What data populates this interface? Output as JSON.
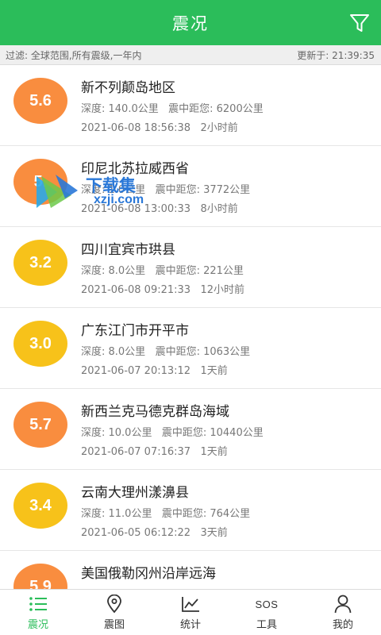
{
  "header": {
    "title": "震况",
    "filter_icon": "filter-icon"
  },
  "filter": {
    "text": "过滤: 全球范围,所有震级,一年内",
    "updated": "更新于: 21:39:35"
  },
  "colors": {
    "green": "#2bbd5a",
    "orange": "#f98d3f",
    "yellow": "#f7c21a"
  },
  "quakes": [
    {
      "mag": "5.6",
      "place": "新不列颠岛地区",
      "info": "深度: 140.0公里   震中距您: 6200公里",
      "time": "2021-06-08 18:56:38   2小时前",
      "color": "#f98d3f"
    },
    {
      "mag": "5.",
      "place": "印尼北苏拉威西省",
      "info": "深度: 1.0公里   震中距您: 3772公里",
      "time": "2021-06-08 13:00:33   8小时前",
      "color": "#f98d3f"
    },
    {
      "mag": "3.2",
      "place": "四川宜宾市珙县",
      "info": "深度: 8.0公里   震中距您: 221公里",
      "time": "2021-06-08 09:21:33   12小时前",
      "color": "#f7c21a"
    },
    {
      "mag": "3.0",
      "place": "广东江门市开平市",
      "info": "深度: 8.0公里   震中距您: 1063公里",
      "time": "2021-06-07 20:13:12   1天前",
      "color": "#f7c21a"
    },
    {
      "mag": "5.7",
      "place": "新西兰克马德克群岛海域",
      "info": "深度: 10.0公里   震中距您: 10440公里",
      "time": "2021-06-07 07:16:37   1天前",
      "color": "#f98d3f"
    },
    {
      "mag": "3.4",
      "place": "云南大理州漾濞县",
      "info": "深度: 11.0公里   震中距您: 764公里",
      "time": "2021-06-05 06:12:22   3天前",
      "color": "#f7c21a"
    },
    {
      "mag": "5.9",
      "place": "美国俄勒冈州沿岸远海",
      "info": "",
      "time": "",
      "color": "#f98d3f"
    }
  ],
  "watermark": {
    "text": "下载集",
    "sub": "xzji.com"
  },
  "tabs": [
    {
      "label": "震况",
      "icon": "list-icon",
      "active": true
    },
    {
      "label": "震图",
      "icon": "map-pin-icon",
      "active": false
    },
    {
      "label": "统计",
      "icon": "chart-icon",
      "active": false
    },
    {
      "label": "工具",
      "icon": "sos-icon",
      "icon_text": "SOS",
      "active": false
    },
    {
      "label": "我的",
      "icon": "user-icon",
      "active": false
    }
  ]
}
